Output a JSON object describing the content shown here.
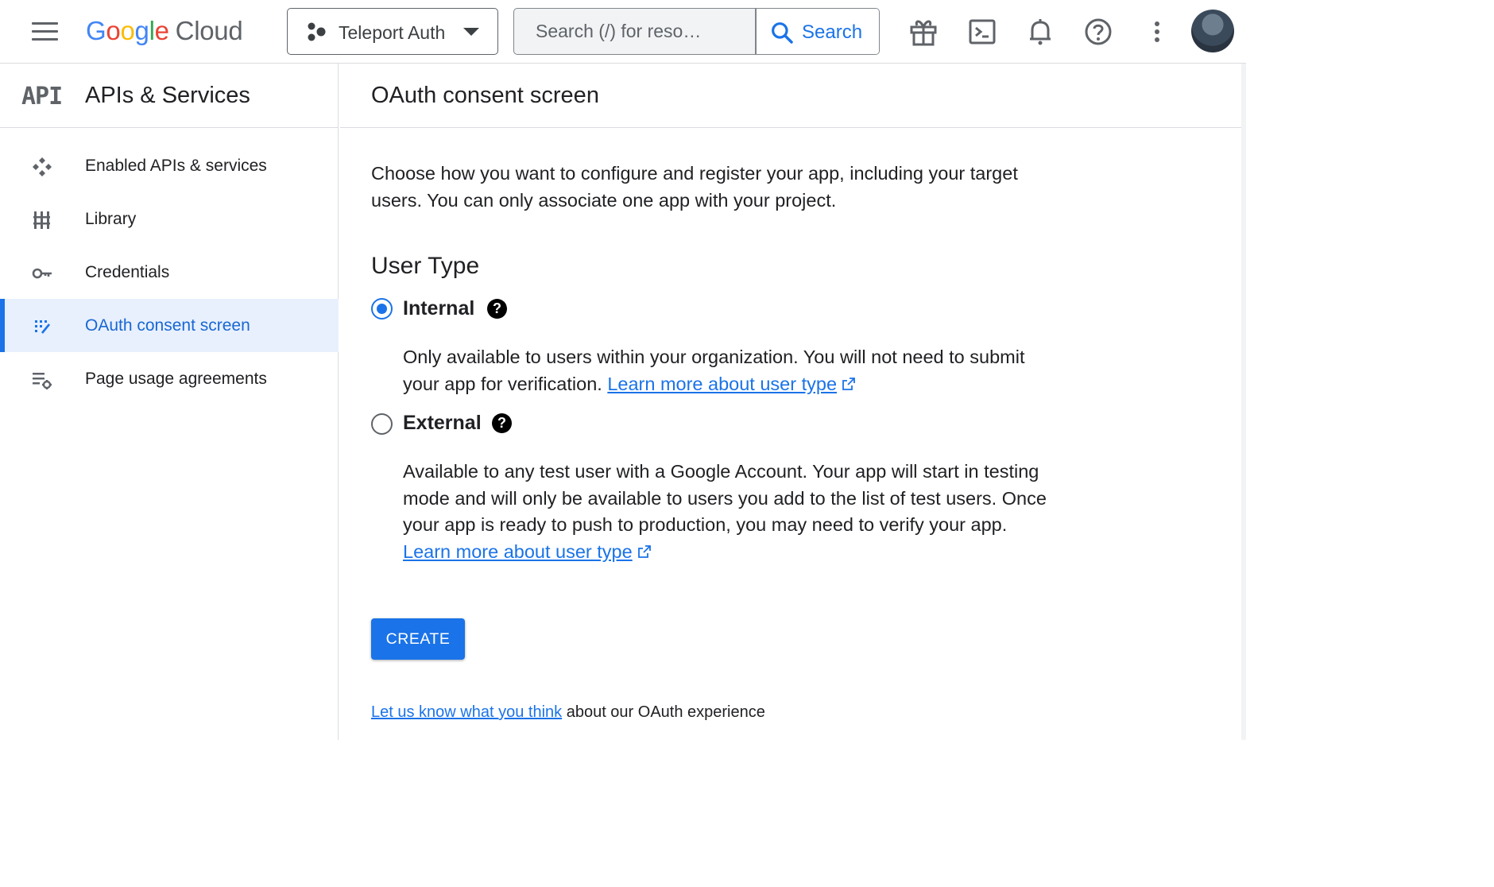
{
  "header": {
    "logo": {
      "google": [
        "G",
        "o",
        "o",
        "g",
        "l",
        "e"
      ],
      "cloud": "Cloud"
    },
    "project_label": "Teleport Auth",
    "search_placeholder": "Search (/) for reso…",
    "search_button": "Search",
    "icons": [
      "menu-icon",
      "gift-icon",
      "terminal-icon",
      "bell-icon",
      "help-icon",
      "more-vert-icon"
    ]
  },
  "sidebar": {
    "logo_text": "API",
    "title": "APIs & Services",
    "items": [
      {
        "label": "Enabled APIs & services",
        "icon": "enabled-apis-icon",
        "active": false
      },
      {
        "label": "Library",
        "icon": "library-icon",
        "active": false
      },
      {
        "label": "Credentials",
        "icon": "key-icon",
        "active": false
      },
      {
        "label": "OAuth consent screen",
        "icon": "oauth-icon",
        "active": true
      },
      {
        "label": "Page usage agreements",
        "icon": "agreements-icon",
        "active": false
      }
    ]
  },
  "main": {
    "title": "OAuth consent screen",
    "intro": "Choose how you want to configure and register your app, including your target users. You can only associate one app with your project.",
    "user_type_heading": "User Type",
    "options": [
      {
        "label": "Internal",
        "checked": true,
        "description": "Only available to users within your organization. You will not need to submit your app for verification.",
        "link": "Learn more about user type"
      },
      {
        "label": "External",
        "checked": false,
        "description": "Available to any test user with a Google Account. Your app will start in testing mode and will only be available to users you add to the list of test users. Once your app is ready to push to production, you may need to verify your app.",
        "link": "Learn more about user type"
      }
    ],
    "create_button": "CREATE",
    "feedback_link": "Let us know what you think",
    "feedback_text": " about our OAuth experience"
  },
  "colors": {
    "accent": "#1a73e8",
    "active_bg": "#e8f0fe",
    "icon_gray": "#5f6368"
  }
}
